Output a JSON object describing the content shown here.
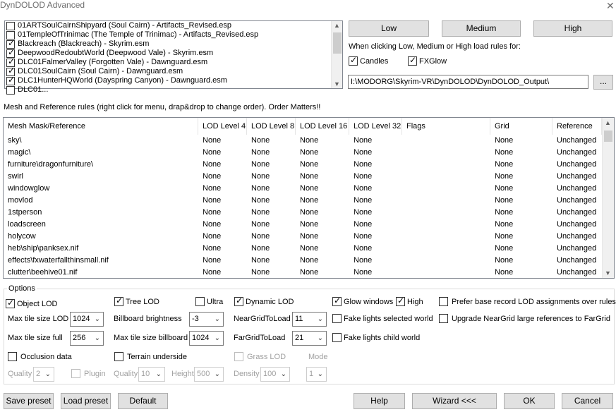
{
  "window": {
    "title": "DynDOLOD Advanced",
    "close_glyph": "✕"
  },
  "plugins": [
    {
      "label": "01ARTSoulCairnShipyard (Soul Cairn) - Artifacts_Revised.esp",
      "checked": false
    },
    {
      "label": "01TempleOfTrinimac (The Temple of Trinimac) - Artifacts_Revised.esp",
      "checked": false
    },
    {
      "label": "Blackreach (Blackreach) - Skyrim.esm",
      "checked": true
    },
    {
      "label": "DeepwoodRedoubtWorld (Deepwood Vale) - Skyrim.esm",
      "checked": true
    },
    {
      "label": "DLC01FalmerValley (Forgotten Vale) - Dawnguard.esm",
      "checked": true
    },
    {
      "label": "DLC01SoulCairn (Soul Cairn) - Dawnguard.esm",
      "checked": true
    },
    {
      "label": "DLC1HunterHQWorld (Dayspring Canyon) - Dawnguard.esm",
      "checked": true
    },
    {
      "label": "DLC01...",
      "checked": false
    }
  ],
  "preset_buttons": {
    "low": "Low",
    "medium": "Medium",
    "high": "High"
  },
  "load_rules": {
    "caption": "When clicking Low, Medium or High load rules for:",
    "candles": {
      "label": "Candles",
      "checked": true
    },
    "fxglow": {
      "label": "FXGlow",
      "checked": true
    }
  },
  "output": {
    "path": "I:\\MODORG\\Skyrim-VR\\DynDOLOD\\DynDOLOD_Output\\",
    "browse": "..."
  },
  "rules_caption": "Mesh and Reference rules (right click for menu, drap&drop to change order). Order Matters!!",
  "grid": {
    "headers": [
      "Mesh Mask/Reference",
      "LOD Level 4",
      "LOD Level 8",
      "LOD Level 16",
      "LOD Level 32",
      "Flags",
      "Grid",
      "Reference"
    ],
    "rows": [
      [
        "sky\\",
        "None",
        "None",
        "None",
        "None",
        "",
        "None",
        "Unchanged"
      ],
      [
        "magic\\",
        "None",
        "None",
        "None",
        "None",
        "",
        "None",
        "Unchanged"
      ],
      [
        "furniture\\dragonfurniture\\",
        "None",
        "None",
        "None",
        "None",
        "",
        "None",
        "Unchanged"
      ],
      [
        "swirl",
        "None",
        "None",
        "None",
        "None",
        "",
        "None",
        "Unchanged"
      ],
      [
        "windowglow",
        "None",
        "None",
        "None",
        "None",
        "",
        "None",
        "Unchanged"
      ],
      [
        "movlod",
        "None",
        "None",
        "None",
        "None",
        "",
        "None",
        "Unchanged"
      ],
      [
        "1stperson",
        "None",
        "None",
        "None",
        "None",
        "",
        "None",
        "Unchanged"
      ],
      [
        "loadscreen",
        "None",
        "None",
        "None",
        "None",
        "",
        "None",
        "Unchanged"
      ],
      [
        "holycow",
        "None",
        "None",
        "None",
        "None",
        "",
        "None",
        "Unchanged"
      ],
      [
        "heb\\ship\\panksex.nif",
        "None",
        "None",
        "None",
        "None",
        "",
        "None",
        "Unchanged"
      ],
      [
        "effects\\fxwaterfallthinsmall.nif",
        "None",
        "None",
        "None",
        "None",
        "",
        "None",
        "Unchanged"
      ],
      [
        "clutter\\beehive01.nif",
        "None",
        "None",
        "None",
        "None",
        "",
        "None",
        "Unchanged"
      ]
    ]
  },
  "options": {
    "legend": "Options",
    "object_lod": {
      "label": "Object LOD",
      "checked": true
    },
    "max_tile_size_lod": {
      "label": "Max tile size LOD",
      "value": "1024"
    },
    "max_tile_size_full": {
      "label": "Max tile size full",
      "value": "256"
    },
    "occlusion_data": {
      "label": "Occlusion data",
      "checked": false
    },
    "quality": {
      "label": "Quality",
      "value": "2"
    },
    "plugin": {
      "label": "Plugin",
      "checked": false
    },
    "tree_lod": {
      "label": "Tree LOD",
      "checked": true
    },
    "ultra": {
      "label": "Ultra",
      "checked": false
    },
    "billboard_brightness": {
      "label": "Billboard brightness",
      "value": "-3"
    },
    "max_tile_size_billboard": {
      "label": "Max tile size billboard",
      "value": "1024"
    },
    "terrain_underside": {
      "label": "Terrain underside",
      "checked": false
    },
    "terrain_quality": {
      "label": "Quality",
      "value": "10"
    },
    "height": {
      "label": "Height",
      "value": "500"
    },
    "dynamic_lod": {
      "label": "Dynamic LOD",
      "checked": true
    },
    "near_grid": {
      "label": "NearGridToLoad",
      "value": "11"
    },
    "far_grid": {
      "label": "FarGridToLoad",
      "value": "21"
    },
    "grass_lod": {
      "label": "Grass LOD",
      "checked": false
    },
    "density": {
      "label": "Density",
      "value": "100"
    },
    "mode": {
      "label": "Mode",
      "value": "1"
    },
    "glow_windows": {
      "label": "Glow windows",
      "checked": true
    },
    "high": {
      "label": "High",
      "checked": true
    },
    "fake_lights_selected": {
      "label": "Fake lights selected world",
      "checked": false
    },
    "fake_lights_child": {
      "label": "Fake lights child world",
      "checked": false
    },
    "prefer_base_record": {
      "label": "Prefer base record LOD assignments over rules",
      "checked": false
    },
    "upgrade_neargrid": {
      "label": "Upgrade NearGrid large references to FarGrid",
      "checked": false
    }
  },
  "footer": {
    "save_preset": "Save preset",
    "load_preset": "Load preset",
    "default": "Default",
    "help": "Help",
    "wizard": "Wizard <<<",
    "ok": "OK",
    "cancel": "Cancel"
  }
}
